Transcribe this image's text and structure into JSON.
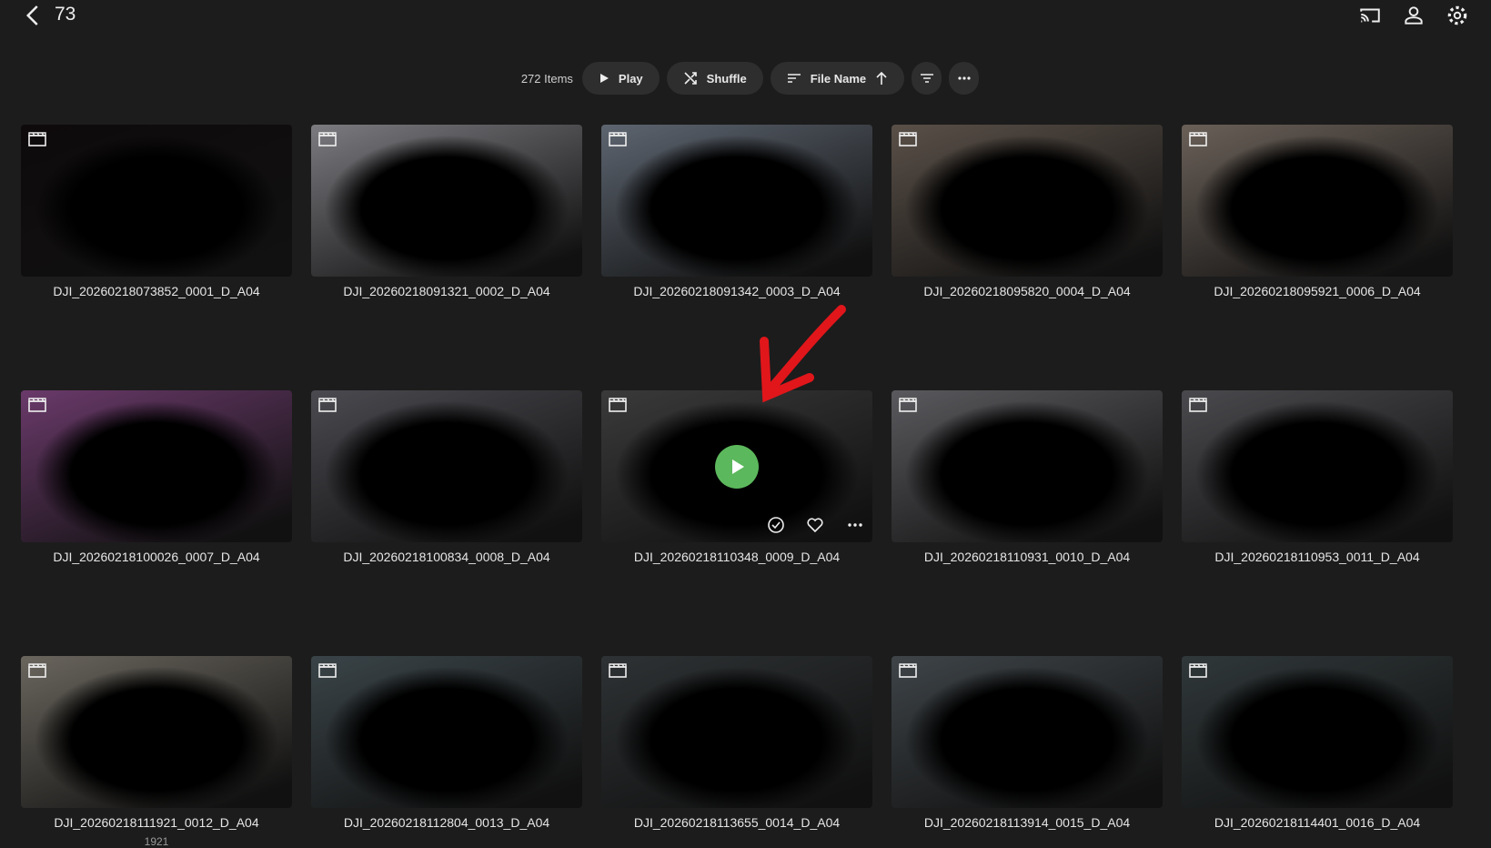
{
  "header": {
    "title": "73",
    "icons": [
      "back-icon",
      "cast-icon",
      "user-icon",
      "settings-icon"
    ]
  },
  "toolbar": {
    "count": "272 Items",
    "play": "Play",
    "shuffle": "Shuffle",
    "sort": "File Name"
  },
  "accent": "#5cb85c",
  "items": [
    {
      "name": "DJI_20260218073852_0001_D_A04",
      "bg": "#0e0a0c"
    },
    {
      "name": "DJI_20260218091321_0002_D_A04",
      "bg": "#7b7b80"
    },
    {
      "name": "DJI_20260218091342_0003_D_A04",
      "bg": "#5d6570"
    },
    {
      "name": "DJI_20260218095820_0004_D_A04",
      "bg": "#5a5048"
    },
    {
      "name": "DJI_20260218095921_0006_D_A04",
      "bg": "#6a6058"
    },
    {
      "name": "DJI_20260218100026_0007_D_A04",
      "bg": "#6a3a6a"
    },
    {
      "name": "DJI_20260218100834_0008_D_A04",
      "bg": "#4a4a50"
    },
    {
      "name": "DJI_20260218110348_0009_D_A04",
      "bg": "#3a3a3a"
    },
    {
      "name": "DJI_20260218110931_0010_D_A04",
      "bg": "#5a5a5e"
    },
    {
      "name": "DJI_20260218110953_0011_D_A04",
      "bg": "#4a4a4e"
    },
    {
      "name": "DJI_20260218111921_0012_D_A04",
      "bg": "#6a665e",
      "sub": "1921"
    },
    {
      "name": "DJI_20260218112804_0013_D_A04",
      "bg": "#3a4448"
    },
    {
      "name": "DJI_20260218113655_0014_D_A04",
      "bg": "#2e3234"
    },
    {
      "name": "DJI_20260218113914_0015_D_A04",
      "bg": "#3e4448"
    },
    {
      "name": "DJI_20260218114401_0016_D_A04",
      "bg": "#30383a"
    }
  ]
}
